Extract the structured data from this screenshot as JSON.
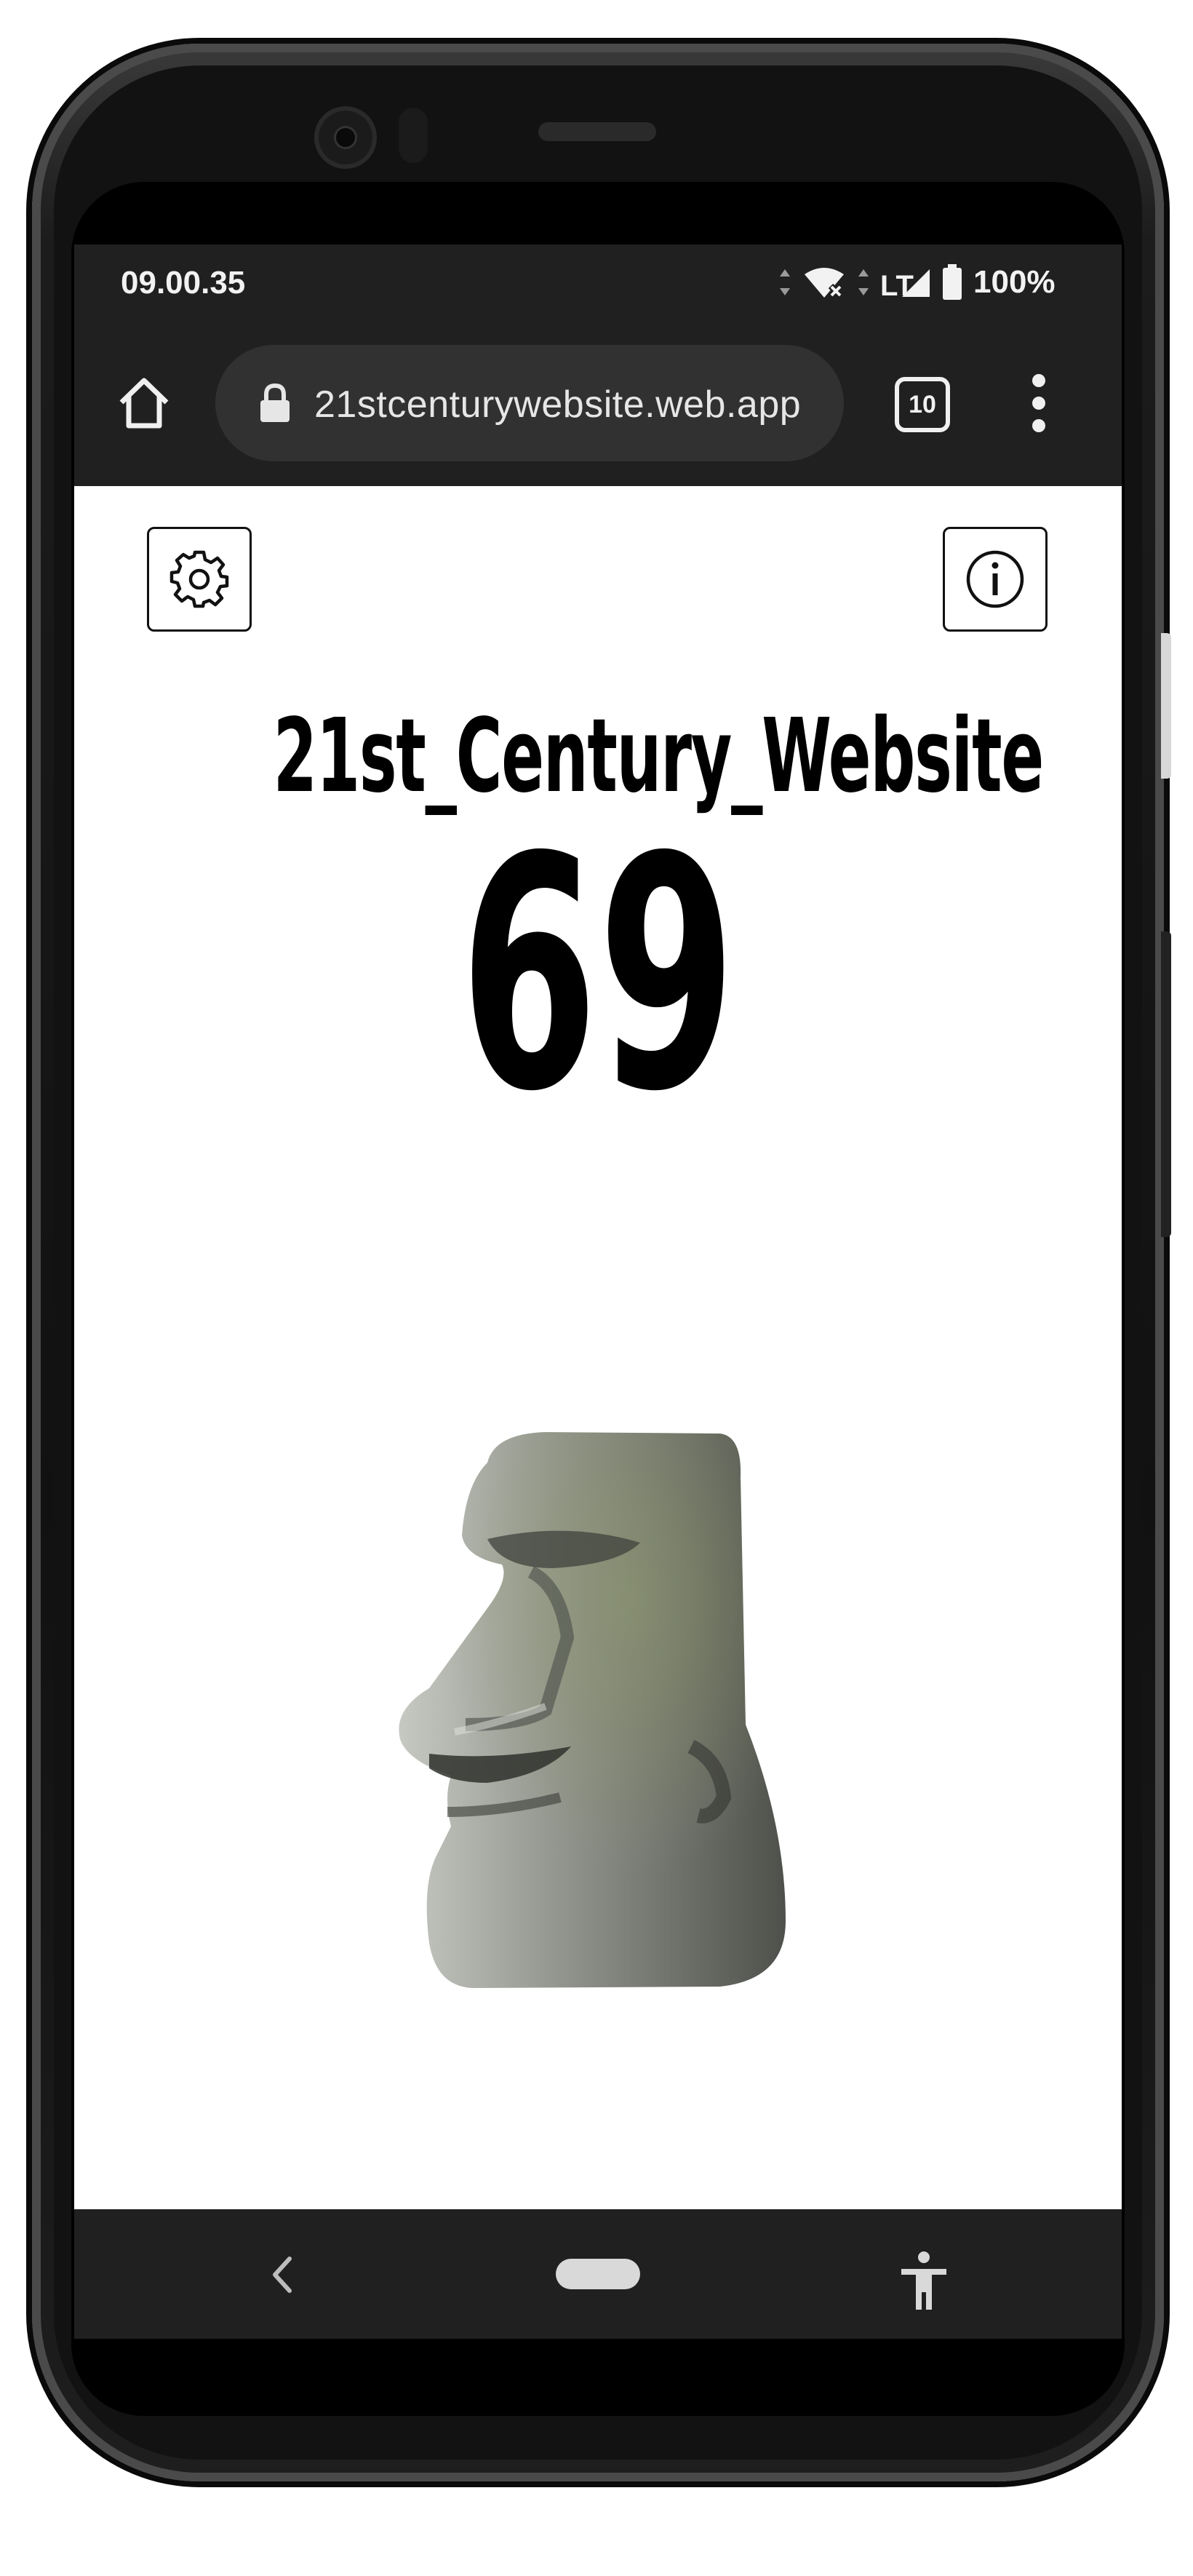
{
  "status_bar": {
    "time": "09.00.35",
    "battery": "100%",
    "icons": [
      "data-arrows-icon",
      "wifi-x-icon",
      "data-arrows-icon",
      "lte-signal-icon",
      "battery-icon"
    ]
  },
  "browser": {
    "url": "21stcenturywebsite.web.app",
    "tab_count": "10",
    "icons": [
      "home-icon",
      "lock-icon",
      "tabs-icon",
      "kebab-menu-icon"
    ]
  },
  "page": {
    "title": "21st_Century_Website",
    "counter": "69",
    "icons": [
      "gear-icon",
      "info-icon"
    ],
    "image": "moai-statue"
  },
  "nav_bar": {
    "icons": [
      "back-chevron-icon",
      "home-pill",
      "accessibility-icon"
    ]
  },
  "colors": {
    "chrome_dark": "#202020",
    "url_bar": "#313131",
    "page_bg": "#ffffff",
    "text": "#000000"
  }
}
